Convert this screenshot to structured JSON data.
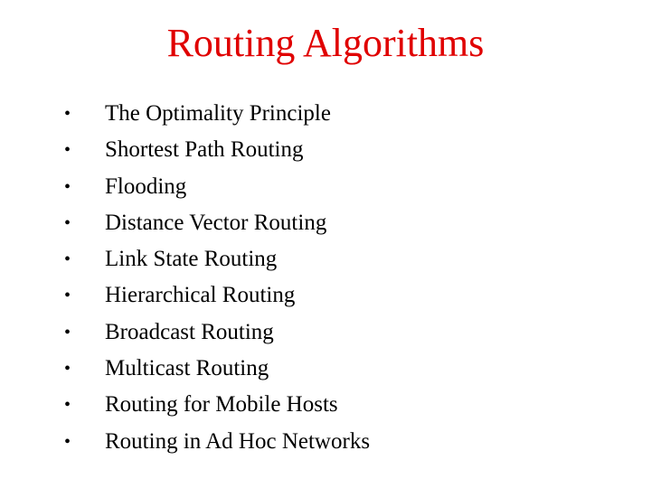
{
  "slide": {
    "title": "Routing Algorithms",
    "title_color": "#e00000",
    "bullet_glyph": "•",
    "items": [
      {
        "label": "The Optimality Principle"
      },
      {
        "label": "Shortest Path Routing"
      },
      {
        "label": "Flooding"
      },
      {
        "label": "Distance Vector Routing"
      },
      {
        "label": "Link State Routing"
      },
      {
        "label": "Hierarchical Routing"
      },
      {
        "label": "Broadcast Routing"
      },
      {
        "label": "Multicast Routing"
      },
      {
        "label": "Routing for Mobile Hosts"
      },
      {
        "label": "Routing in Ad Hoc Networks"
      }
    ]
  }
}
